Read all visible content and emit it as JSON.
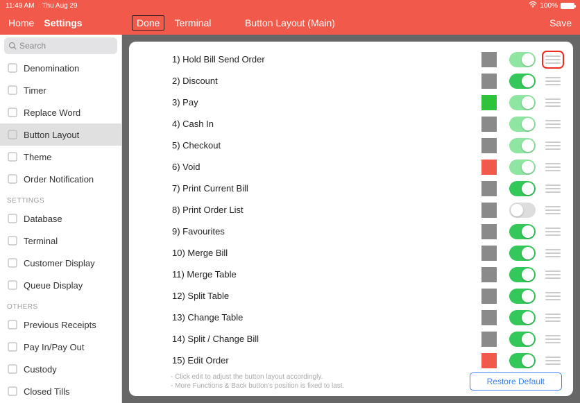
{
  "status": {
    "time": "11:49 AM",
    "date": "Thu Aug 29",
    "battery": "100%"
  },
  "nav": {
    "home": "Home",
    "settings": "Settings",
    "done": "Done",
    "terminal": "Terminal",
    "title": "Button Layout (Main)",
    "save": "Save"
  },
  "search": {
    "placeholder": "Search"
  },
  "sidebar": {
    "groups": [
      {
        "header": null,
        "items": [
          {
            "label": "Denomination",
            "icon": "coins-icon"
          },
          {
            "label": "Timer",
            "icon": "hourglass-icon"
          },
          {
            "label": "Replace Word",
            "icon": "swap-icon"
          },
          {
            "label": "Button Layout",
            "icon": "list-icon",
            "active": true
          },
          {
            "label": "Theme",
            "icon": "palette-icon"
          },
          {
            "label": "Order Notification",
            "icon": "bell-icon"
          }
        ]
      },
      {
        "header": "SETTINGS",
        "items": [
          {
            "label": "Database",
            "icon": "database-icon"
          },
          {
            "label": "Terminal",
            "icon": "terminal-icon"
          },
          {
            "label": "Customer Display",
            "icon": "display-icon"
          },
          {
            "label": "Queue Display",
            "icon": "queue-icon"
          }
        ]
      },
      {
        "header": "OTHERS",
        "items": [
          {
            "label": "Previous Receipts",
            "icon": "receipt-icon"
          },
          {
            "label": "Pay In/Pay Out",
            "icon": "cash-icon"
          },
          {
            "label": "Custody",
            "icon": "lock-icon"
          },
          {
            "label": "Closed Tills",
            "icon": "till-icon"
          }
        ]
      }
    ]
  },
  "colors": {
    "gray": "#8a8a8a",
    "green": "#2fc23b",
    "red": "#f15a4a",
    "toggleGreen": "#34c759",
    "toggleSoftGreen": "#8fe5a2"
  },
  "rows": [
    {
      "n": 1,
      "label": "1) Hold Bill Send Order",
      "swatch": "#8a8a8a",
      "on": true,
      "soft": true,
      "hlHandle": true
    },
    {
      "n": 2,
      "label": "2) Discount",
      "swatch": "#8a8a8a",
      "on": true,
      "soft": false
    },
    {
      "n": 3,
      "label": "3) Pay",
      "swatch": "#2fc23b",
      "on": true,
      "soft": true
    },
    {
      "n": 4,
      "label": "4) Cash In",
      "swatch": "#8a8a8a",
      "on": true,
      "soft": true
    },
    {
      "n": 5,
      "label": "5) Checkout",
      "swatch": "#8a8a8a",
      "on": true,
      "soft": true
    },
    {
      "n": 6,
      "label": "6) Void",
      "swatch": "#f15a4a",
      "on": true,
      "soft": true
    },
    {
      "n": 7,
      "label": "7) Print Current Bill",
      "swatch": "#8a8a8a",
      "on": true,
      "soft": false
    },
    {
      "n": 8,
      "label": "8) Print Order List",
      "swatch": "#8a8a8a",
      "on": false,
      "soft": false
    },
    {
      "n": 9,
      "label": "9) Favourites",
      "swatch": "#8a8a8a",
      "on": true,
      "soft": false
    },
    {
      "n": 10,
      "label": "10) Merge Bill",
      "swatch": "#8a8a8a",
      "on": true,
      "soft": false
    },
    {
      "n": 11,
      "label": "11) Merge Table",
      "swatch": "#8a8a8a",
      "on": true,
      "soft": false
    },
    {
      "n": 12,
      "label": "12) Split Table",
      "swatch": "#8a8a8a",
      "on": true,
      "soft": false
    },
    {
      "n": 13,
      "label": "13) Change Table",
      "swatch": "#8a8a8a",
      "on": true,
      "soft": false
    },
    {
      "n": 14,
      "label": "14) Split / Change Bill",
      "swatch": "#8a8a8a",
      "on": true,
      "soft": false
    },
    {
      "n": 15,
      "label": "15) Edit Order",
      "swatch": "#f15a4a",
      "on": true,
      "soft": false
    }
  ],
  "hints": {
    "line1": "- Click edit to adjust the button layout accordingly.",
    "line2": "- More Functions & Back button's position is fixed to last."
  },
  "restore": "Restore Default"
}
